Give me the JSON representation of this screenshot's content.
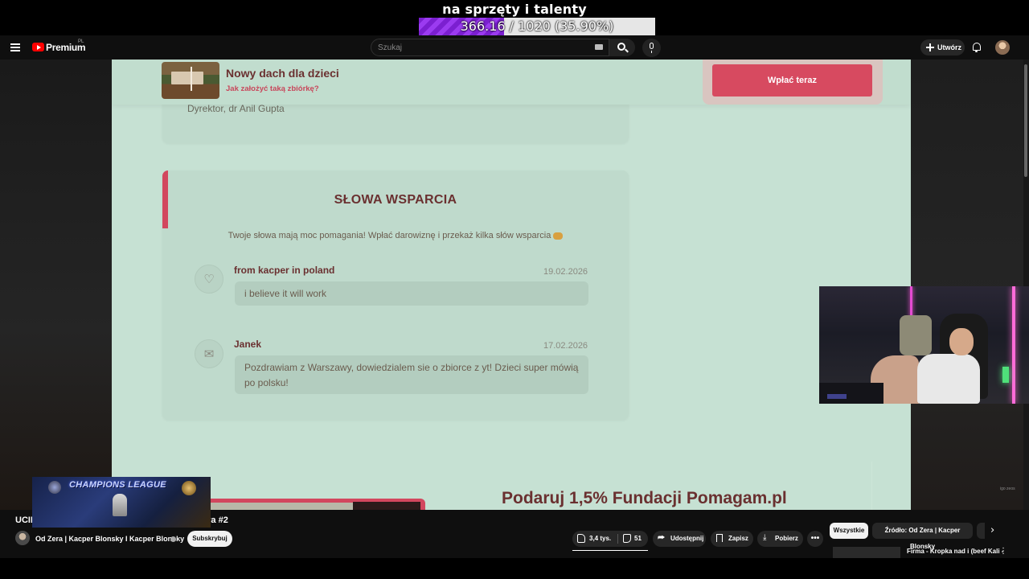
{
  "overlay": {
    "goal_title": "na sprzęty i talenty",
    "goal_text": "366.16 / 1020 (35.90%)",
    "goal_progress": 0.359,
    "goal_color": "#8a2be2"
  },
  "header": {
    "brand": "Premium",
    "region": "PL",
    "search_placeholder": "Szukaj",
    "create_label": "Utwórz",
    "icons": [
      "menu-icon",
      "youtube-logo",
      "keyboard-icon",
      "search-icon",
      "mic-icon",
      "plus-icon",
      "bell-icon",
      "avatar"
    ]
  },
  "fundraiser": {
    "title": "Nowy dach dla dzieci",
    "how_to_link": "Jak założyć taką zbiórkę?",
    "donate_label": "Wpłać teraz",
    "director": "Dyrektor, dr Anil Gupta",
    "support_title": "SŁOWA WSPARCIA",
    "support_subtitle": "Twoje słowa mają moc pomagania! Wpłać darowiznę i przekaż kilka słów wsparcia",
    "entries": [
      {
        "author": "from kacper in poland",
        "date": "19.02.2026",
        "message": "i believe it will work",
        "icon": "heart-hand-icon"
      },
      {
        "author": "Janek",
        "date": "17.02.2026",
        "message": "Pozdrawiam z Warszawy, dowiedzialem sie o zbiorce z yt! Dzieci super mówią po polsku!",
        "icon": "mail-heart-icon"
      }
    ],
    "promo_title": "Podaruj 1,5% Fundacji Pomagam.pl",
    "accent_color": "#d74a60",
    "background_color": "#c6e1d3"
  },
  "video": {
    "title": "UCII",
    "title_suffix": "era #2",
    "overlay_text": "CHAMPIONS LEAGUE",
    "channel": "Od Zera | Kacper Blonsky I Kacper Blonsky",
    "subscribe_label": "Subskrybuj",
    "likes": "3,4 tys.",
    "dislikes": "51",
    "share_label": "Udostępnij",
    "save_label": "Zapisz",
    "download_label": "Pobierz",
    "more_label": "•••",
    "watermark": "igo zeos"
  },
  "chips": {
    "all_label": "Wszystkie",
    "source_label": "Źródło: Od Zera | Kacper Blonsky"
  },
  "recommendations": [
    {
      "title": "Firma - Kropka nad i (beef Kali -"
    }
  ]
}
